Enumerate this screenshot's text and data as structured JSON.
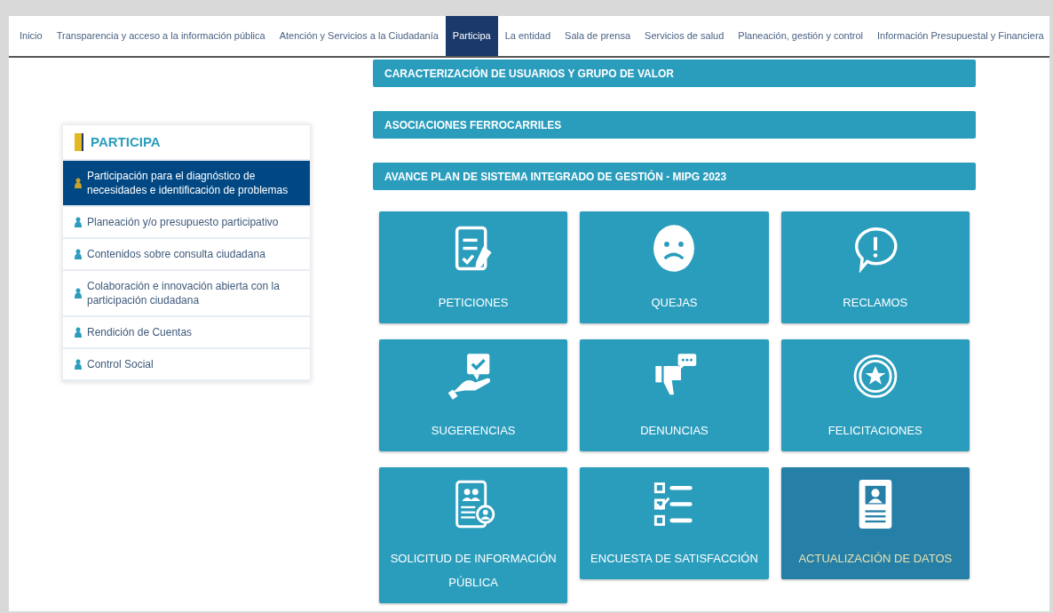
{
  "nav": [
    {
      "label": "Inicio",
      "selected": false
    },
    {
      "label": "Transparencia y acceso a la información pública",
      "selected": false
    },
    {
      "label": "Atención y Servicios a la Ciudadanía",
      "selected": false
    },
    {
      "label": "Participa",
      "selected": true
    },
    {
      "label": "La entidad",
      "selected": false
    },
    {
      "label": "Sala de prensa",
      "selected": false
    },
    {
      "label": "Servicios de salud",
      "selected": false
    },
    {
      "label": "Planeación, gestión y control",
      "selected": false
    },
    {
      "label": "Información Presupuestal y Financiera",
      "selected": false
    }
  ],
  "sidebar": {
    "title": "PARTICIPA",
    "items": [
      {
        "label": "Participación para el diagnóstico de necesidades e identificación de problemas",
        "selected": true
      },
      {
        "label": "Planeación y/o presupuesto participativo",
        "selected": false
      },
      {
        "label": "Contenidos sobre consulta ciudadana",
        "selected": false
      },
      {
        "label": "Colaboración e innovación abierta con la participación ciudadana",
        "selected": false
      },
      {
        "label": "Rendición de Cuentas",
        "selected": false
      },
      {
        "label": "Control Social",
        "selected": false
      }
    ]
  },
  "sections": [
    "CARACTERIZACIÓN DE USUARIOS Y GRUPO DE VALOR",
    "ASOCIACIONES FERROCARRILES",
    "AVANCE PLAN DE SISTEMA INTEGRADO DE GESTIÓN - MIPG 2023"
  ],
  "tiles": [
    {
      "label": "PETICIONES",
      "highlighted": false
    },
    {
      "label": "QUEJAS",
      "highlighted": false
    },
    {
      "label": "RECLAMOS",
      "highlighted": false
    },
    {
      "label": "SUGERENCIAS",
      "highlighted": false
    },
    {
      "label": "DENUNCIAS",
      "highlighted": false
    },
    {
      "label": "FELICITACIONES",
      "highlighted": false
    },
    {
      "label": "SOLICITUD DE INFORMACIÓN PÚBLICA",
      "highlighted": false
    },
    {
      "label": "ENCUESTA DE SATISFACCIÓN",
      "highlighted": false
    },
    {
      "label": "ACTUALIZACIÓN DE DATOS",
      "highlighted": true
    }
  ]
}
